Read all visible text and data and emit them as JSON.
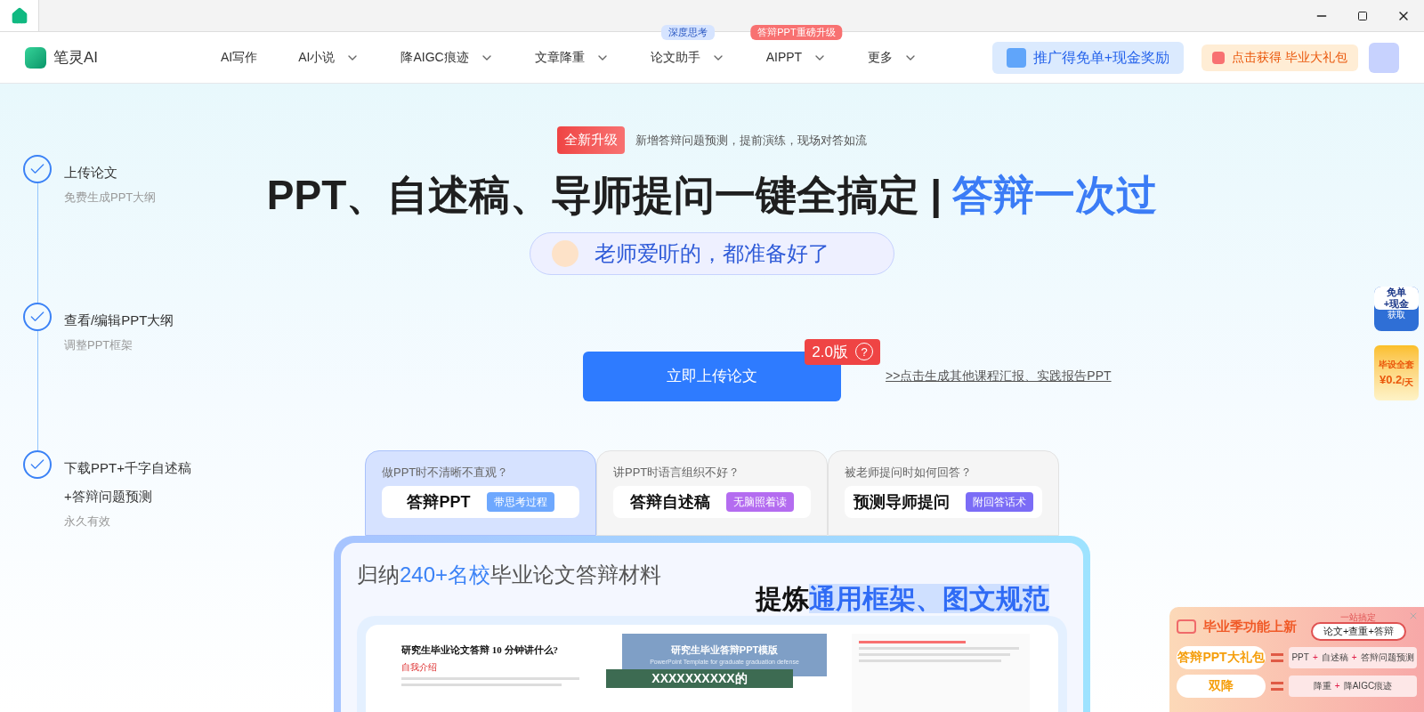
{
  "nav": {
    "logo": "笔灵AI",
    "items": [
      {
        "label": "AI写作",
        "dropdown": false
      },
      {
        "label": "AI小说",
        "dropdown": true
      },
      {
        "label": "降AIGC痕迹",
        "dropdown": true
      },
      {
        "label": "文章降重",
        "dropdown": true
      },
      {
        "label": "论文助手",
        "dropdown": true,
        "badge": {
          "text": "深度思考",
          "color": "#d6e4ff"
        }
      },
      {
        "label": "AIPPT",
        "dropdown": true,
        "badge": {
          "text": "答辩PPT重磅升级",
          "color": "#f87171"
        }
      },
      {
        "label": "更多",
        "dropdown": true
      }
    ],
    "promo": "推广得免单+现金奖励",
    "gift": "点击获得 毕业大礼包"
  },
  "steps": [
    {
      "title_lines": [
        "上传论文"
      ],
      "subtitle": "免费生成PPT大纲",
      "checked": true
    },
    {
      "title_lines": [
        "查看/编辑PPT大纲"
      ],
      "subtitle": "调整PPT框架",
      "checked": true
    },
    {
      "title_lines": [
        "下载PPT+千字自述稿",
        "+答辩问题预测"
      ],
      "subtitle": "永久有效",
      "checked": true
    }
  ],
  "hero": {
    "badge": "全新升级",
    "note": "新增答辩问题预测，提前演练，现场对答如流",
    "headline": "PPT、自述稿、导师提问一键全搞定",
    "divider": "|",
    "highlight": "答辩一次过",
    "pill": "老师爱听的，都准备好了",
    "upload_button": "立即上传论文",
    "version": "2.0版",
    "help": "?",
    "link": ">>点击生成其他课程汇报、实践报告PPT"
  },
  "tabs": [
    {
      "question": "做PPT时不清晰不直观？",
      "title": "答辩PPT",
      "tag": "带思考过程",
      "color": "#6ea8fe",
      "selected": true
    },
    {
      "question": "讲PPT时语言组织不好？",
      "title": "答辩自述稿",
      "tag": "无脑照着读",
      "color": "#b46cf0",
      "selected": false
    },
    {
      "question": "被老师提问时如何回答？",
      "title": "预测导师提问",
      "tag": "附回答话术",
      "color": "#7b6cf6",
      "selected": false
    }
  ],
  "showcase": {
    "heading": [
      {
        "text": "归纳",
        "accent": false
      },
      {
        "text": "240+名校",
        "accent": true
      },
      {
        "text": "毕业论文答辩材料",
        "accent": false
      }
    ],
    "subheading": [
      {
        "text": "提炼",
        "accent": false
      },
      {
        "text": "通用框架、图文规范",
        "accent": true
      }
    ],
    "doc1": {
      "title": "研究生毕业论文答辩 10 分钟讲什么?",
      "section": "自我介绍"
    },
    "doc2": {
      "title": "研究生毕业答辩PPT模版",
      "subtitle": "PowerPoint Template for graduate graduation defense",
      "cover": "XXXXXXXXXX的"
    }
  },
  "float": {
    "free": [
      "免单",
      "+现金",
      "获取"
    ],
    "kit": [
      "毕设全套",
      "¥0.2",
      "/天"
    ]
  },
  "popup": {
    "title": "毕业季功能上新",
    "caption": "一站搞定",
    "combo": "论文+查重+答辩",
    "plus": "+",
    "rows": [
      {
        "tag": "答辩PPT大礼包",
        "items": [
          "PPT",
          "自述稿",
          "答辩问题预测"
        ]
      },
      {
        "tag": "双降",
        "items": [
          "降重",
          "降AIGC痕迹"
        ]
      }
    ]
  }
}
